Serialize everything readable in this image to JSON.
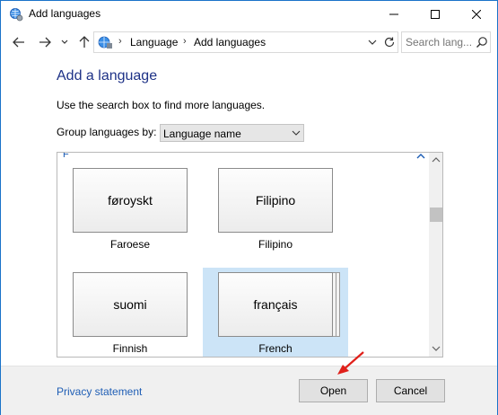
{
  "window": {
    "title": "Add languages",
    "title_icon": "globe-settings-icon"
  },
  "nav": {
    "back_icon": "arrow-left-icon",
    "forward_icon": "arrow-right-icon",
    "recent_icon": "chevron-down-icon",
    "up_icon": "arrow-up-icon",
    "breadcrumbs": [
      "Language",
      "Add languages"
    ],
    "search_placeholder": "Search lang..."
  },
  "content": {
    "heading": "Add a language",
    "instruction": "Use the search box to find more languages.",
    "group_label": "Group languages by:",
    "group_value": "Language name",
    "section_letter": "F"
  },
  "tiles": [
    {
      "native": "føroyskt",
      "caption": "Faroese",
      "selected": false
    },
    {
      "native": "Filipino",
      "caption": "Filipino",
      "selected": false
    },
    {
      "native": "suomi",
      "caption": "Finnish",
      "selected": false
    },
    {
      "native": "français",
      "caption": "French",
      "selected": true
    }
  ],
  "footer": {
    "privacy_link": "Privacy statement",
    "open_label": "Open",
    "cancel_label": "Cancel"
  },
  "colors": {
    "accent": "#1a73c9",
    "heading": "#1e3287",
    "link": "#1f5eb5",
    "selection": "#cce4f7",
    "annotation_arrow": "#e0201a"
  }
}
